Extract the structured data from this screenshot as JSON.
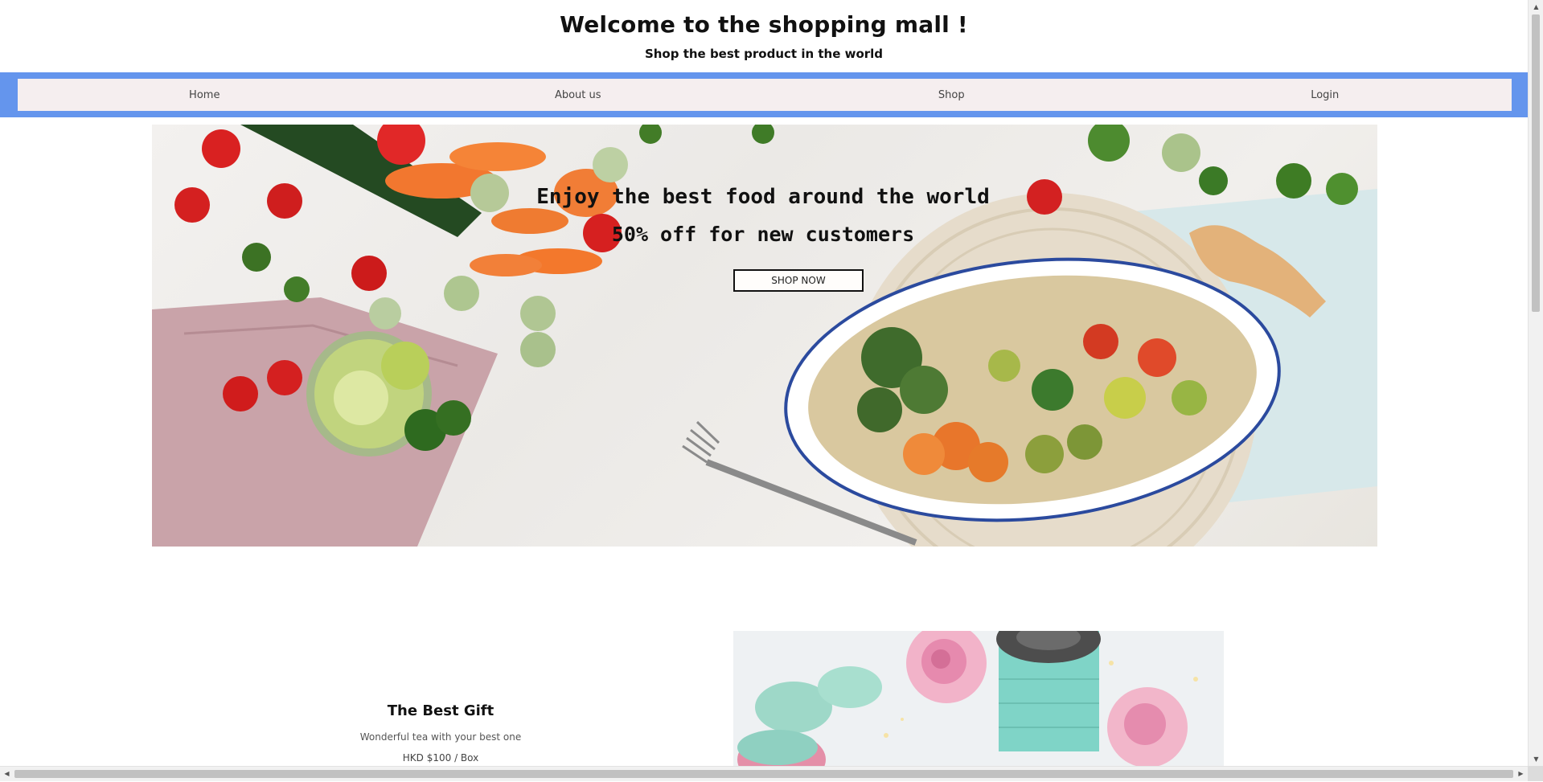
{
  "header": {
    "title": "Welcome to the shopping mall !",
    "subtitle": "Shop the best product in the world"
  },
  "nav": {
    "items": [
      {
        "label": "Home"
      },
      {
        "label": "About us"
      },
      {
        "label": "Shop"
      },
      {
        "label": "Login"
      }
    ],
    "band_color": "#6495ED",
    "bar_color": "#F5EEEF"
  },
  "hero": {
    "heading": "Enjoy the best food around the world",
    "subheading": "50% off for new customers",
    "button_label": "SHOP NOW",
    "image": "vegetable-bowl-photo"
  },
  "product": {
    "name": "The Best Gift",
    "description": "Wonderful tea with your best one",
    "price": "HKD $100 / Box",
    "image": "gift-roses-macarons-photo"
  },
  "scrollbars": {
    "vertical_icons": [
      "arrow-up-icon",
      "arrow-down-icon"
    ],
    "horizontal_icons": [
      "arrow-left-icon",
      "arrow-right-icon"
    ]
  }
}
